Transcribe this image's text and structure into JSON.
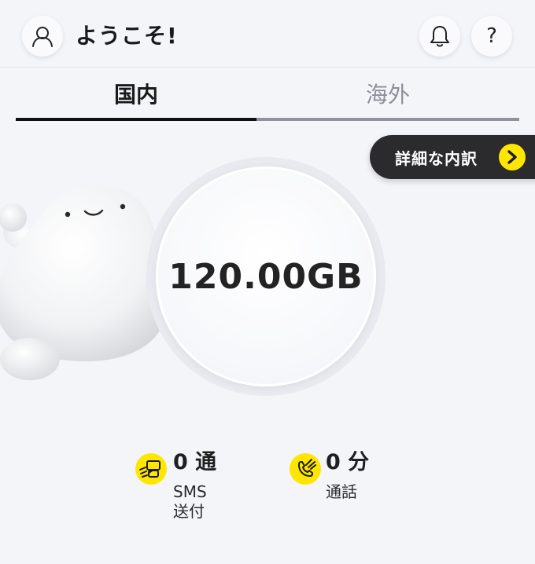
{
  "header": {
    "welcome": "ようこそ!",
    "help_label": "?",
    "icons": {
      "avatar": "user-outline-icon",
      "notifications": "bell-icon"
    }
  },
  "tabs": [
    {
      "label": "国内",
      "active": true
    },
    {
      "label": "海外",
      "active": false
    }
  ],
  "detail_button": {
    "label": "詳細な内訳",
    "icon": "chevron-right-icon"
  },
  "usage": {
    "amount": "120.00GB"
  },
  "stats": {
    "sms": {
      "value": "0 通",
      "label_line1": "SMS",
      "label_line2": "送付",
      "icon": "sms-bubble-icon"
    },
    "call": {
      "value": "0 分",
      "label": "通話",
      "icon": "phone-call-icon"
    }
  },
  "colors": {
    "accent": "#ffe600",
    "dark_pill": "#2b2b2d",
    "background": "#f4f5f9"
  }
}
